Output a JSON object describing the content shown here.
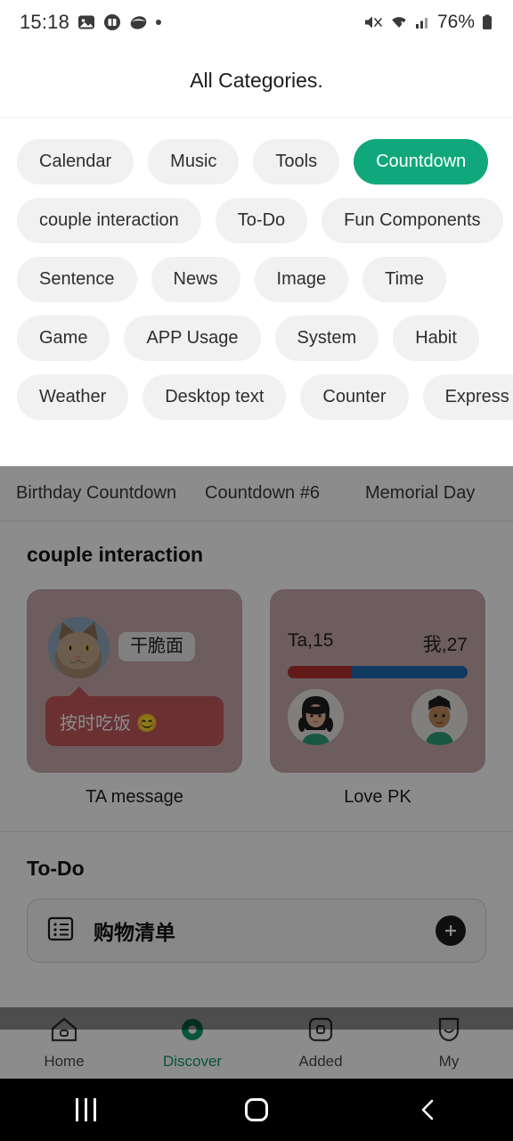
{
  "status_bar": {
    "time": "15:18",
    "left_icons": [
      "image-icon",
      "payment-icon",
      "app-icon",
      "dot-icon"
    ],
    "right_icons": [
      "mute-icon",
      "wifi-icon",
      "signal-icon"
    ],
    "battery_text": "76%",
    "battery_icon": "battery-icon"
  },
  "header": {
    "title": "All Categories."
  },
  "categories": {
    "rows": [
      [
        {
          "label": "Calendar",
          "active": false
        },
        {
          "label": "Music",
          "active": false
        },
        {
          "label": "Tools",
          "active": false
        },
        {
          "label": "Countdown",
          "active": true
        }
      ],
      [
        {
          "label": "couple interaction",
          "active": false
        },
        {
          "label": "To-Do",
          "active": false
        },
        {
          "label": "Fun Components",
          "active": false
        }
      ],
      [
        {
          "label": "Sentence",
          "active": false
        },
        {
          "label": "News",
          "active": false
        },
        {
          "label": "Image",
          "active": false
        },
        {
          "label": "Time",
          "active": false
        }
      ],
      [
        {
          "label": "Game",
          "active": false
        },
        {
          "label": "APP Usage",
          "active": false
        },
        {
          "label": "System",
          "active": false
        },
        {
          "label": "Habit",
          "active": false
        }
      ],
      [
        {
          "label": "Weather",
          "active": false
        },
        {
          "label": "Desktop text",
          "active": false
        },
        {
          "label": "Counter",
          "active": false
        },
        {
          "label": "Express",
          "active": false
        }
      ]
    ],
    "active_color": "#10a87b",
    "chip_bg": "#f1f1f1"
  },
  "sub_tabs": [
    {
      "label": "Birthday Countdown"
    },
    {
      "label": "Countdown #6"
    },
    {
      "label": "Memorial Day"
    }
  ],
  "sections": [
    {
      "title": "couple interaction",
      "cards": [
        {
          "label": "TA message",
          "preview": {
            "avatar": "cat-avatar",
            "name_tag": "干脆面",
            "bubble_text": "按时吃饭 😊",
            "bubble_color": "#c1585b",
            "card_bg": "#c9a9ab"
          }
        },
        {
          "label": "Love PK",
          "preview": {
            "left_label": "Ta,15",
            "right_label": "我,27",
            "left_value": 15,
            "right_value": 27,
            "left_color": "#b3302d",
            "right_color": "#1f6bb0",
            "card_bg": "#c9a9ab",
            "left_avatar": "woman-avatar",
            "right_avatar": "man-avatar"
          }
        }
      ]
    },
    {
      "title": "To-Do",
      "todo_card": {
        "icon": "list-icon",
        "title": "购物清单",
        "add_icon": "plus-icon"
      }
    }
  ],
  "bottom_nav": {
    "items": [
      {
        "label": "Home",
        "icon": "home-icon",
        "active": false
      },
      {
        "label": "Discover",
        "icon": "discover-icon",
        "active": true
      },
      {
        "label": "Added",
        "icon": "added-icon",
        "active": false
      },
      {
        "label": "My",
        "icon": "profile-icon",
        "active": false
      }
    ],
    "active_color": "#0f9a6e"
  },
  "system_nav": {
    "recents": "recents-icon",
    "home": "home-square-icon",
    "back": "back-chevron-icon"
  }
}
